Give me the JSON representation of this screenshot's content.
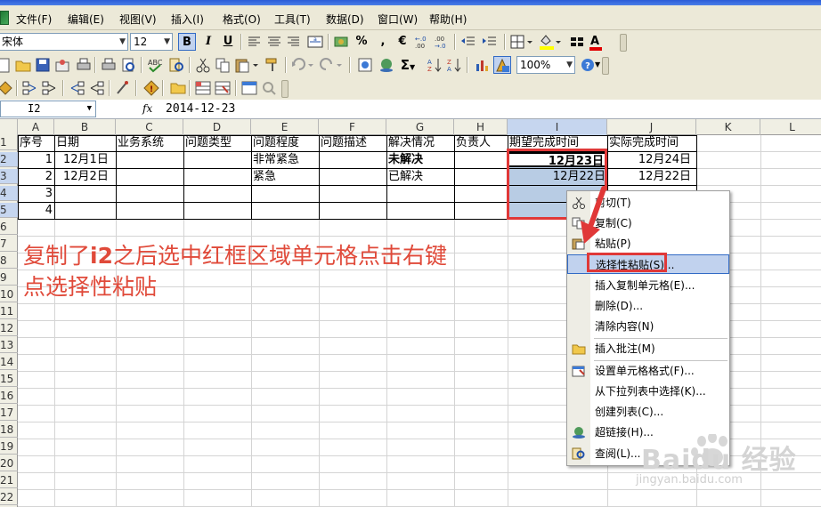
{
  "menubar": {
    "items": [
      "文件(F)",
      "编辑(E)",
      "视图(V)",
      "插入(I)",
      "格式(O)",
      "工具(T)",
      "数据(D)",
      "窗口(W)",
      "帮助(H)"
    ]
  },
  "toolbar_format": {
    "font_name": "宋体",
    "font_size": "12",
    "bold": "B",
    "italic": "I",
    "underline": "U",
    "percent": "%",
    "comma": ",",
    "euro": "€",
    "font_color_letter": "A"
  },
  "toolbar_standard": {
    "sum": "Σ",
    "zoom": "100%"
  },
  "formula_bar": {
    "name_box": "I2",
    "fx": "fx",
    "value": "2014-12-23"
  },
  "columns": [
    "A",
    "B",
    "C",
    "D",
    "E",
    "F",
    "G",
    "H",
    "I",
    "J",
    "K",
    "L"
  ],
  "rows": [
    "1",
    "2",
    "3",
    "4",
    "5",
    "6",
    "7",
    "8",
    "9",
    "10",
    "11",
    "12",
    "13",
    "14",
    "15",
    "16",
    "17",
    "18",
    "19",
    "20",
    "21",
    "22"
  ],
  "sheet": {
    "headers": [
      "序号",
      "日期",
      "业务系统",
      "问题类型",
      "问题程度",
      "问题描述",
      "解决情况",
      "负责人",
      "期望完成时间",
      "实际完成时间"
    ],
    "rows": [
      {
        "seq": "1",
        "date": "12月1日",
        "level": "非常紧急",
        "status": "未解决",
        "expected": "12月23日",
        "actual": "12月24日"
      },
      {
        "seq": "2",
        "date": "12月2日",
        "level": "紧急",
        "status": "已解决",
        "expected": "12月22日",
        "actual": "12月22日"
      },
      {
        "seq": "3"
      },
      {
        "seq": "4"
      }
    ]
  },
  "annotation": {
    "line1_a": "复制了",
    "line1_b": "i2",
    "line1_c": "之后选中红框区域单元格点击右键",
    "line2": "点选择性粘贴"
  },
  "context_menu": {
    "items": [
      {
        "label": "剪切(T)",
        "icon": "scissors-icon"
      },
      {
        "label": "复制(C)",
        "icon": "copy-icon"
      },
      {
        "label": "粘贴(P)",
        "icon": "paste-icon"
      },
      {
        "label": "选择性粘贴(S)...",
        "icon": ""
      },
      {
        "label": "插入复制单元格(E)...",
        "icon": ""
      },
      {
        "label": "删除(D)...",
        "icon": ""
      },
      {
        "label": "清除内容(N)",
        "icon": ""
      },
      {
        "label": "插入批注(M)",
        "icon": "comment-icon"
      },
      {
        "label": "设置单元格格式(F)...",
        "icon": "format-cells-icon"
      },
      {
        "label": "从下拉列表中选择(K)...",
        "icon": ""
      },
      {
        "label": "创建列表(C)...",
        "icon": ""
      },
      {
        "label": "超链接(H)...",
        "icon": "hyperlink-icon"
      },
      {
        "label": "查阅(L)...",
        "icon": "research-icon"
      }
    ]
  },
  "watermark": {
    "brand": "Baidu 经验",
    "url": "jingyan.baidu.com"
  }
}
